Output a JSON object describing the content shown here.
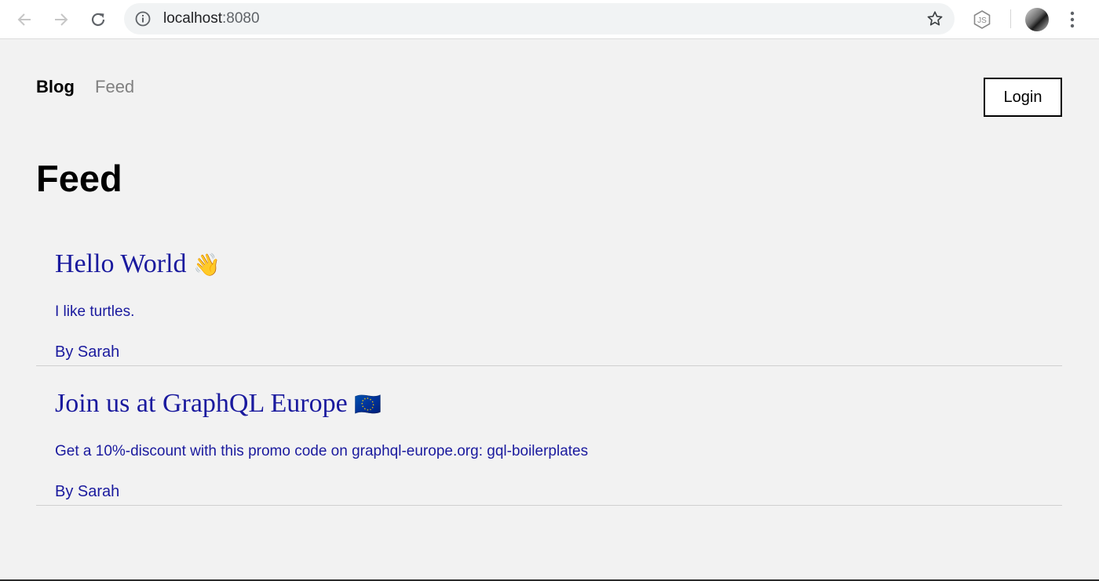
{
  "browser": {
    "url_host": "localhost",
    "url_port": ":8080",
    "icons": [
      "back-arrow-icon",
      "forward-arrow-icon",
      "reload-icon",
      "info-icon",
      "star-icon",
      "nodejs-extension-icon",
      "avatar",
      "more-menu-icon"
    ]
  },
  "nav": {
    "blog_label": "Blog",
    "feed_label": "Feed",
    "login_label": "Login"
  },
  "page": {
    "title": "Feed"
  },
  "posts": [
    {
      "title": "Hello World",
      "emoji": "👋",
      "body": "I like turtles.",
      "author": "By Sarah"
    },
    {
      "title": "Join us at GraphQL Europe",
      "emoji": "🇪🇺",
      "body": "Get a 10%-discount with this promo code on graphql-europe.org: gql-boilerplates",
      "author": "By Sarah"
    }
  ],
  "colors": {
    "link_blue": "#1a1a9e",
    "background": "#f2f2f2"
  }
}
